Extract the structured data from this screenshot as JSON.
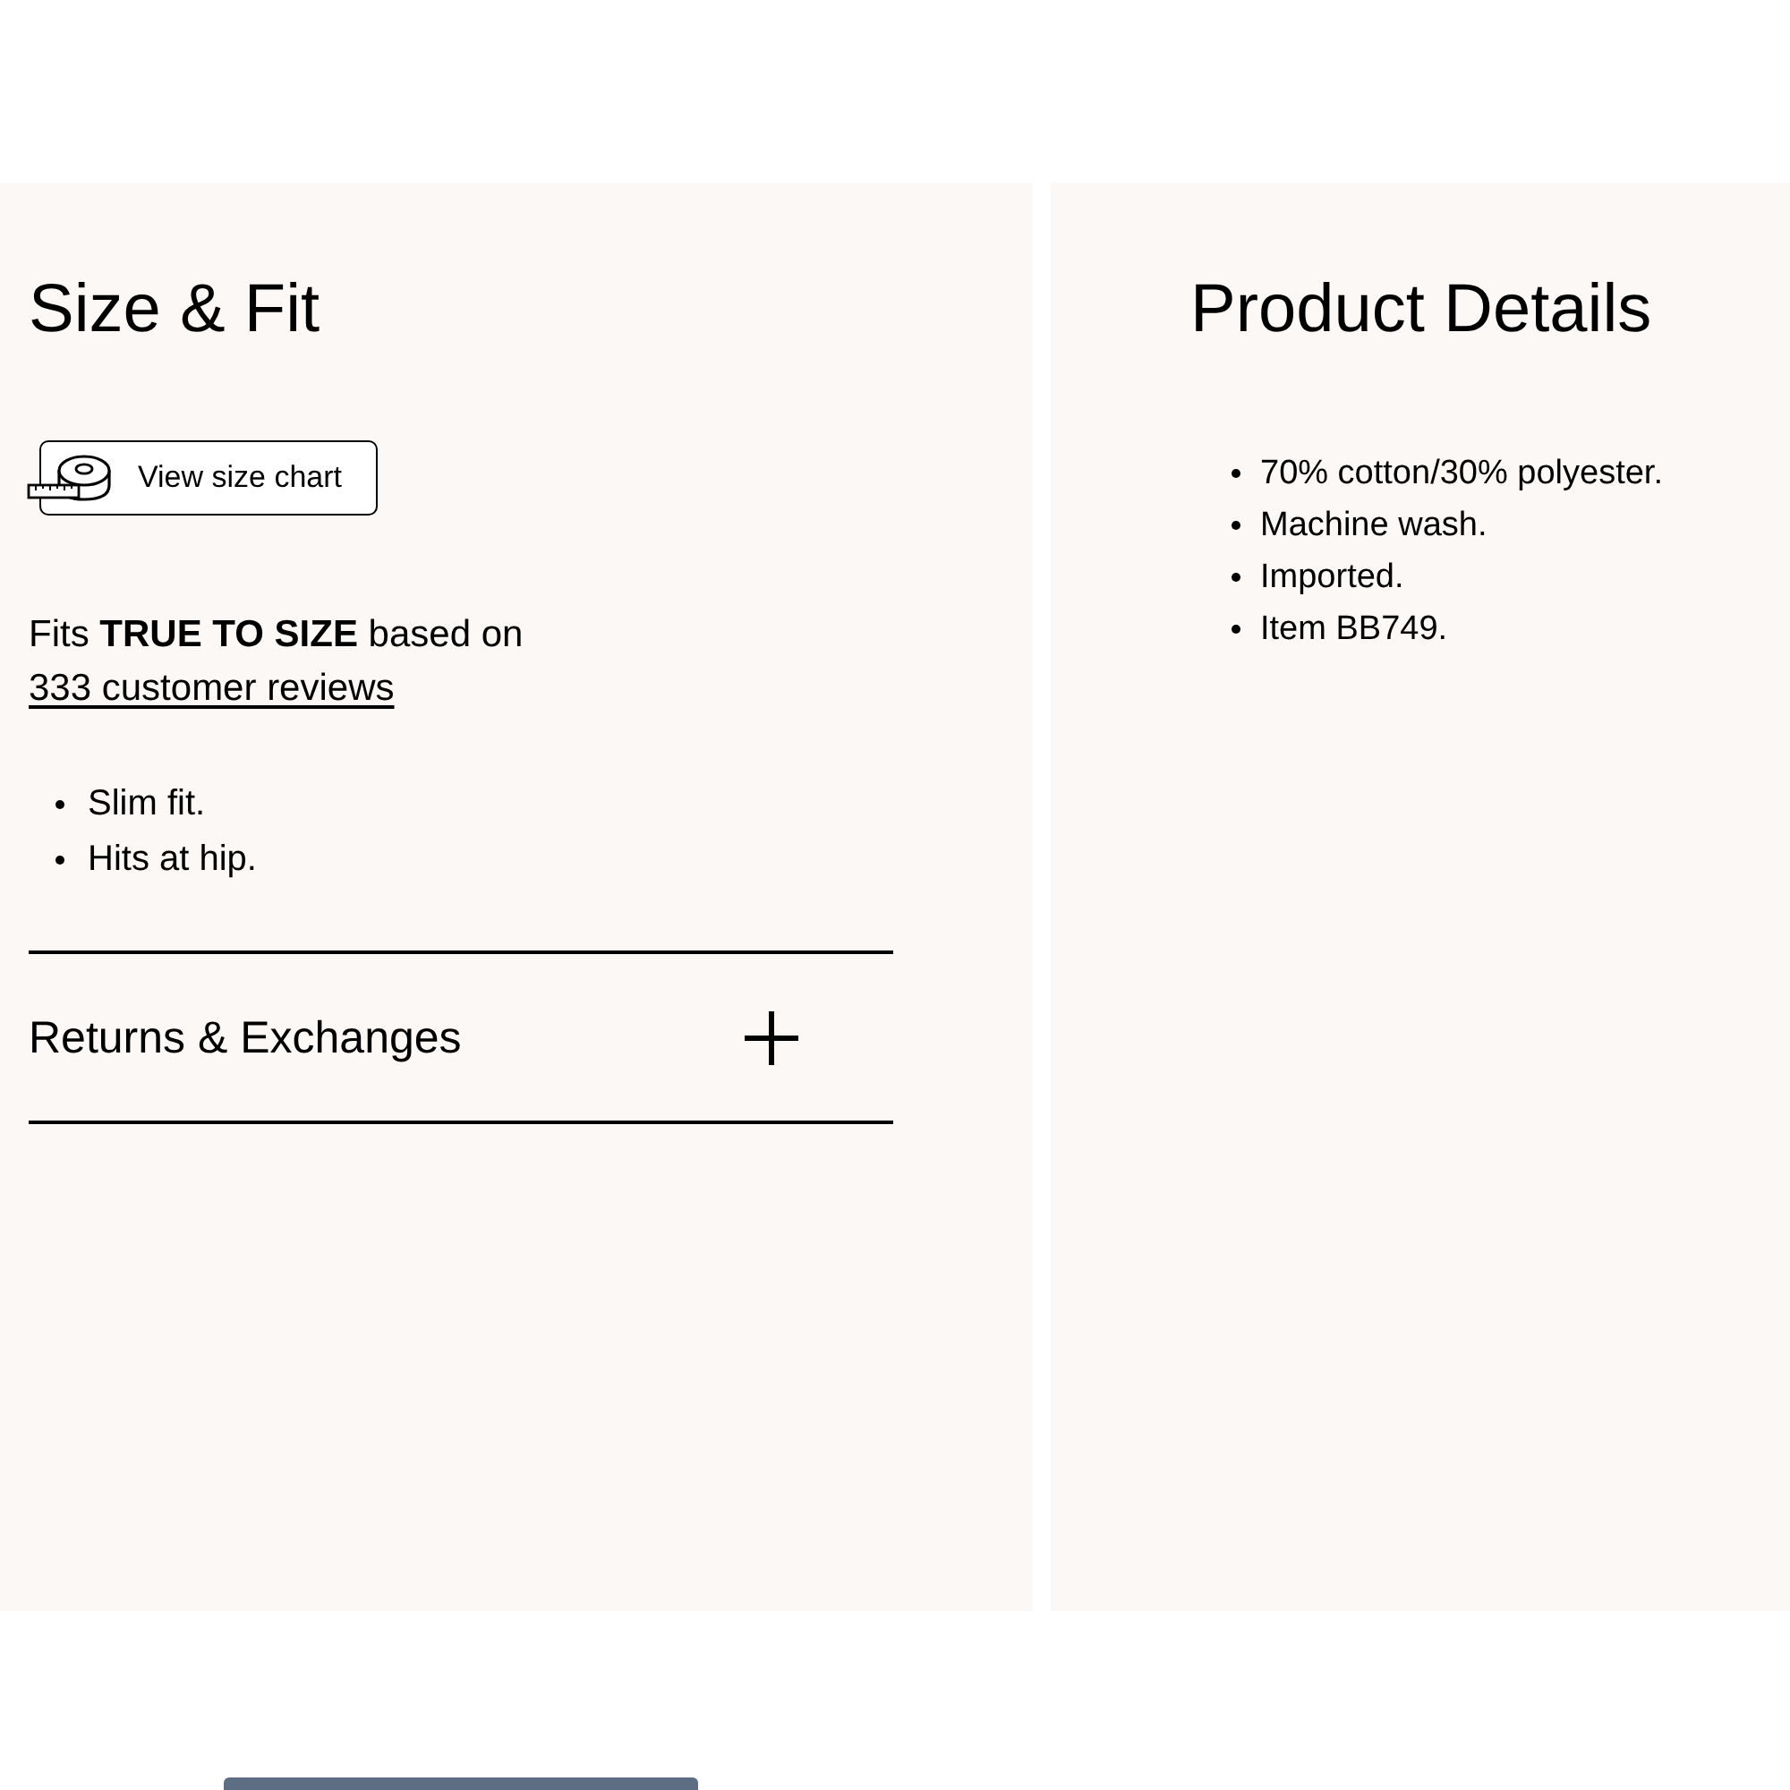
{
  "size_fit": {
    "heading": "Size & Fit",
    "size_chart_button": "View size chart",
    "fit_note": {
      "text": "Fits **TRUE TO SIZE** based on",
      "link": "333 customer reviews"
    },
    "bullets": [
      "Slim fit.",
      "Hits at hip."
    ]
  },
  "accordion": [
    {
      "label": "Returns & Exchanges",
      "expanded": false
    }
  ],
  "product_details": {
    "heading": "Product Details",
    "bullets": [
      "70% cotton/30% polyester.",
      "Machine wash.",
      "Imported.",
      "Item BB749."
    ]
  }
}
